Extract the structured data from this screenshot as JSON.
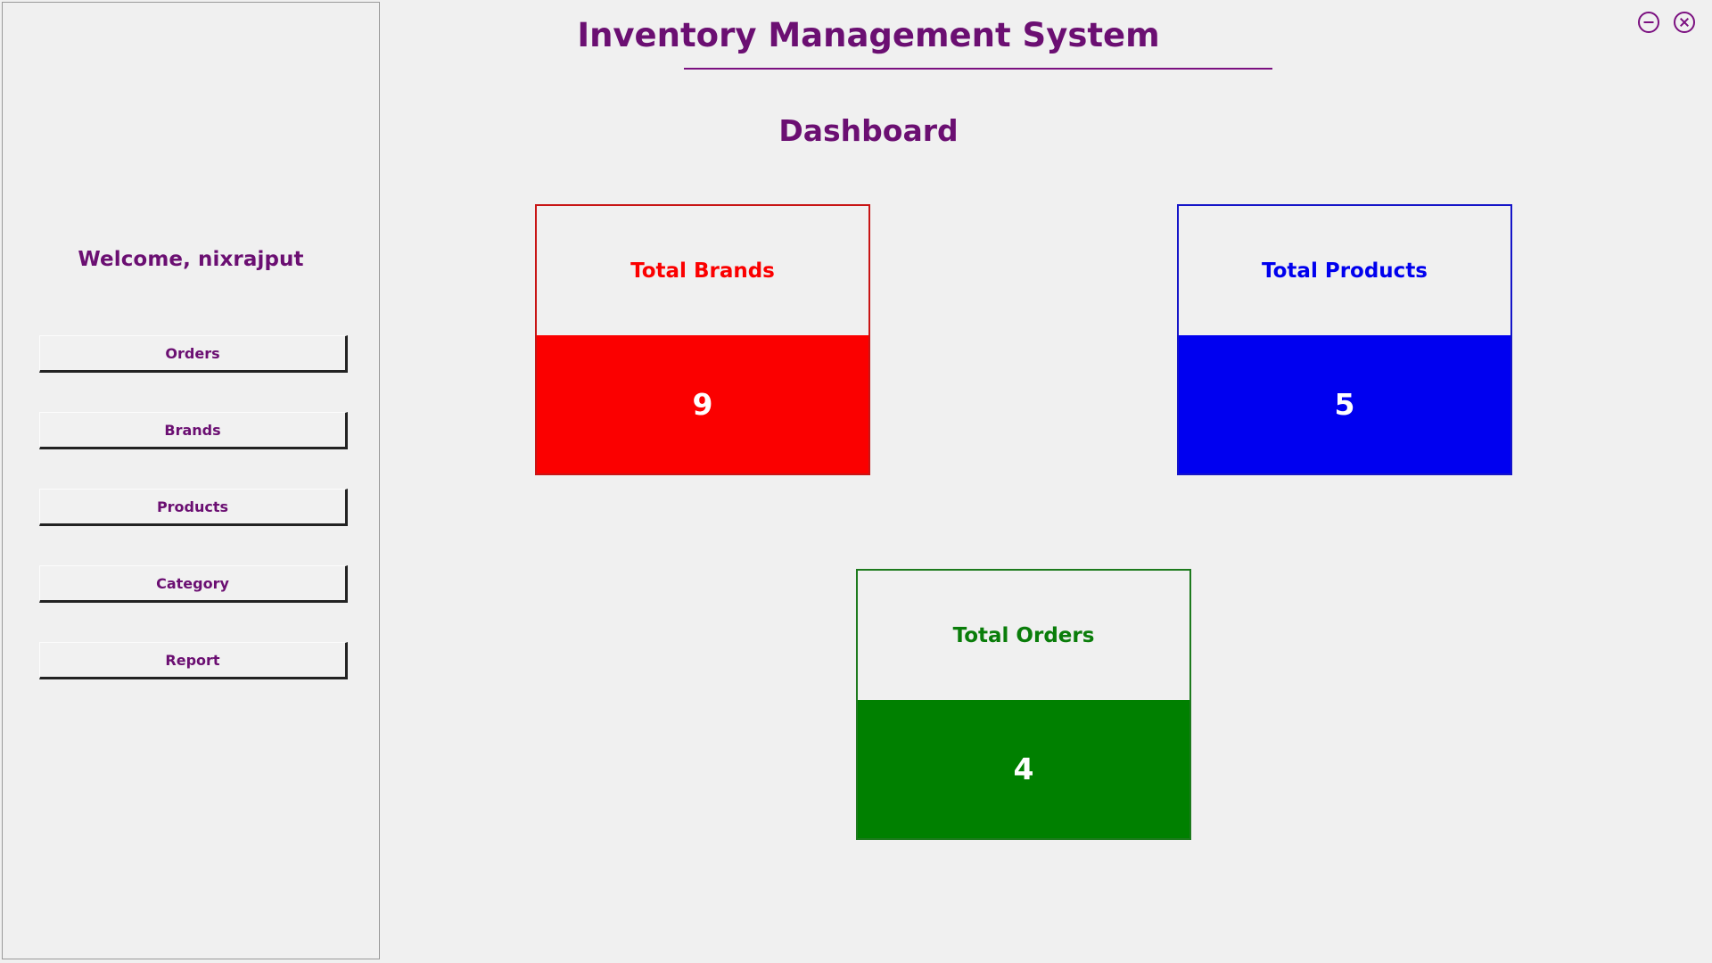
{
  "window": {
    "title": "Inventory Management System",
    "controls": [
      {
        "name": "minimize-button",
        "icon": "minus-circle-icon",
        "label": "⊖"
      },
      {
        "name": "close-button",
        "icon": "close-circle-icon",
        "label": "⊗"
      }
    ],
    "accent_color": "#6b0f72"
  },
  "sidebar": {
    "welcome": "Welcome, nixrajput",
    "items": [
      {
        "label": "Orders"
      },
      {
        "label": "Brands"
      },
      {
        "label": "Products"
      },
      {
        "label": "Category"
      },
      {
        "label": "Report"
      }
    ]
  },
  "main": {
    "page_title": "Dashboard",
    "cards": [
      {
        "title": "Total Brands",
        "value": "9",
        "color": "#fb0000",
        "border_color": "#c81515"
      },
      {
        "title": "Total Products",
        "value": "5",
        "color": "#0000f0",
        "border_color": "#1515c8"
      },
      {
        "title": "Total Orders",
        "value": "4",
        "color": "#008000",
        "border_color": "#1d7a1d"
      }
    ]
  }
}
